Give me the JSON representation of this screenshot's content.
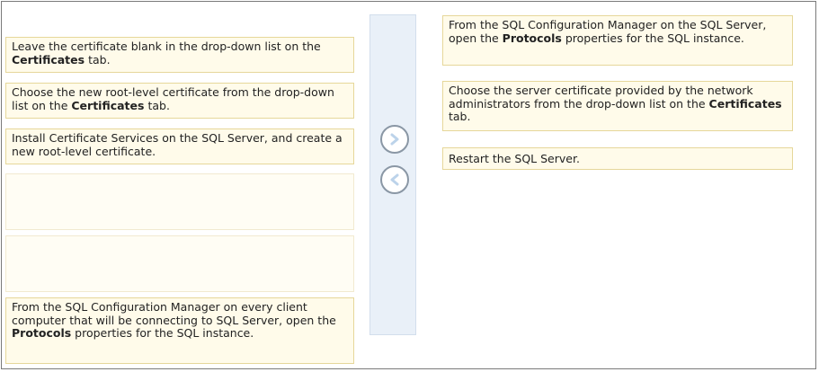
{
  "left_items": [
    {
      "segments": [
        "Leave the certificate blank in the drop-down list on the ",
        "Certificates",
        " tab."
      ]
    },
    {
      "segments": [
        "Choose the new root-level certificate from the drop-down list on the ",
        "Certificates",
        " tab."
      ]
    },
    {
      "segments": [
        "Install Certificate Services on the SQL Server, and create a new root-level certificate.",
        "",
        ""
      ]
    },
    {
      "segments": [
        "From the SQL Configuration Manager on every client computer that will be connecting to SQL Server, open the ",
        "Protocols",
        " properties for the SQL instance."
      ]
    }
  ],
  "right_items": [
    {
      "segments": [
        "From the SQL Configuration Manager on the SQL Server, open the ",
        "Protocols",
        " properties for the SQL instance."
      ]
    },
    {
      "segments": [
        "Choose the server certificate provided by the network administrators from the drop-down list on the ",
        "Certificates",
        " tab."
      ]
    },
    {
      "segments": [
        "Restart the SQL Server.",
        "",
        ""
      ]
    }
  ],
  "icons": {
    "move_right": "chevron-right-icon",
    "move_left": "chevron-left-icon"
  },
  "colors": {
    "item_bg": "#fffbea",
    "item_border": "#e6d79a",
    "divider_bg": "#e9f0f8",
    "arrow": "#8a97a5"
  }
}
